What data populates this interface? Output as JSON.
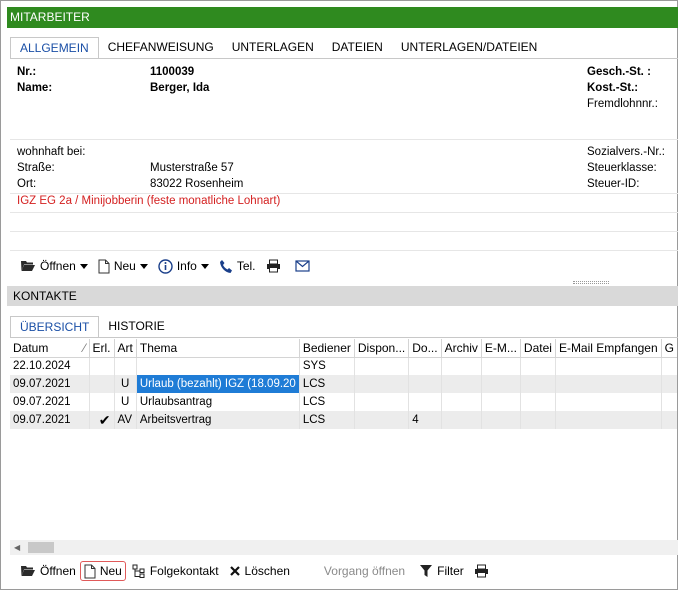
{
  "window": {
    "title": "MITARBEITER"
  },
  "tabs": [
    {
      "label": "ALLGEMEIN",
      "active": true
    },
    {
      "label": "CHEFANWEISUNG"
    },
    {
      "label": "UNTERLAGEN"
    },
    {
      "label": "DATEIEN"
    },
    {
      "label": "UNTERLAGEN/DATEIEN"
    }
  ],
  "employee": {
    "nr_label": "Nr.:",
    "nr_value": "1100039",
    "name_label": "Name:",
    "name_value": "Berger, Ida",
    "gesch_st_label": "Gesch.-St. :",
    "kost_st_label": "Kost.-St.:",
    "fremdlohn_label": "Fremdlohnnr.:",
    "wohnhaft_label": "wohnhaft bei:",
    "strasse_label": "Straße:",
    "strasse_value": "Musterstraße 57",
    "ort_label": "Ort:",
    "ort_value": "83022 Rosenheim",
    "sozial_label": "Sozialvers.-Nr.:",
    "steuerklasse_label": "Steuerklasse:",
    "steuerid_label": "Steuer-ID:",
    "note": "IGZ EG 2a / Minijobberin (feste monatliche Lohnart)"
  },
  "toolbar1": {
    "open": "Öffnen",
    "new": "Neu",
    "info": "Info",
    "tel": "Tel."
  },
  "kontakte": {
    "title": "KONTAKTE",
    "tabs": [
      {
        "label": "ÜBERSICHT",
        "active": true
      },
      {
        "label": "HISTORIE"
      }
    ],
    "columns": [
      "Datum",
      "Erl.",
      "Art",
      "Thema",
      "Bediener",
      "Dispon...",
      "Do...",
      "Archiv",
      "E-M...",
      "Datei",
      "E-Mail Empfangen",
      "G"
    ],
    "rows": [
      {
        "datum": "22.10.2024",
        "erl": "",
        "art": "",
        "thema": "",
        "bediener": "SYS",
        "dispon": "",
        "do": ""
      },
      {
        "datum": "09.07.2021",
        "erl": "",
        "art": "U",
        "thema": "Urlaub (bezahlt) IGZ (18.09.20",
        "bediener": "LCS",
        "dispon": "",
        "do": ""
      },
      {
        "datum": "09.07.2021",
        "erl": "",
        "art": "U",
        "thema": "Urlaubsantrag",
        "bediener": "LCS",
        "dispon": "",
        "do": ""
      },
      {
        "datum": "09.07.2021",
        "erl": "✔",
        "art": "AV",
        "thema": "Arbeitsvertrag",
        "bediener": "LCS",
        "dispon": "",
        "do": "4"
      }
    ]
  },
  "toolbar2": {
    "open": "Öffnen",
    "new": "Neu",
    "folgekontakt": "Folgekontakt",
    "loeschen": "Löschen",
    "vorgang": "Vorgang öffnen",
    "filter": "Filter"
  }
}
